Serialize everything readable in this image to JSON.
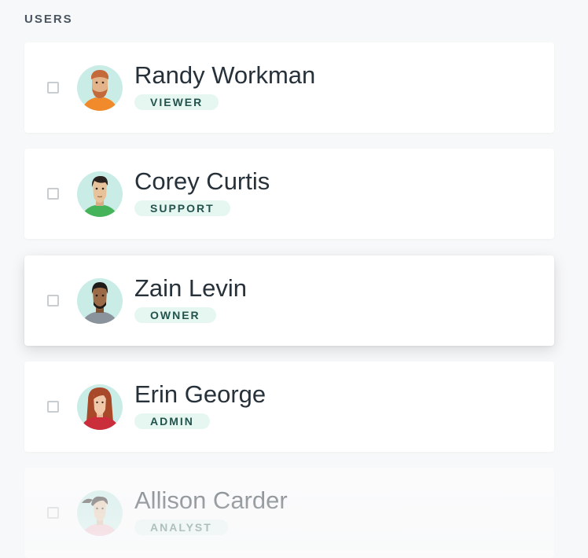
{
  "section": {
    "title": "USERS"
  },
  "users": [
    {
      "name": "Randy Workman",
      "role": "VIEWER",
      "avatar_icon": "bearded-man-avatar-icon",
      "shirt": "#f08a2a",
      "skin": "#e3b48a",
      "hair": "#c4693a"
    },
    {
      "name": "Corey Curtis",
      "role": "SUPPORT",
      "avatar_icon": "man-avatar-icon",
      "shirt": "#45b35a",
      "skin": "#e8c29a",
      "hair": "#2a2320"
    },
    {
      "name": "Zain Levin",
      "role": "OWNER",
      "avatar_icon": "man-avatar-icon",
      "shirt": "#8a939b",
      "skin": "#9b6a46",
      "hair": "#1e1a17"
    },
    {
      "name": "Erin George",
      "role": "ADMIN",
      "avatar_icon": "woman-avatar-icon",
      "shirt": "#c92e3a",
      "skin": "#f0c9ab",
      "hair": "#a84a2a"
    },
    {
      "name": "Allison Carder",
      "role": "ANALYST",
      "avatar_icon": "woman-avatar-icon",
      "shirt": "#f2b7c3",
      "skin": "#e6c4a6",
      "hair": "#2b2623"
    }
  ]
}
